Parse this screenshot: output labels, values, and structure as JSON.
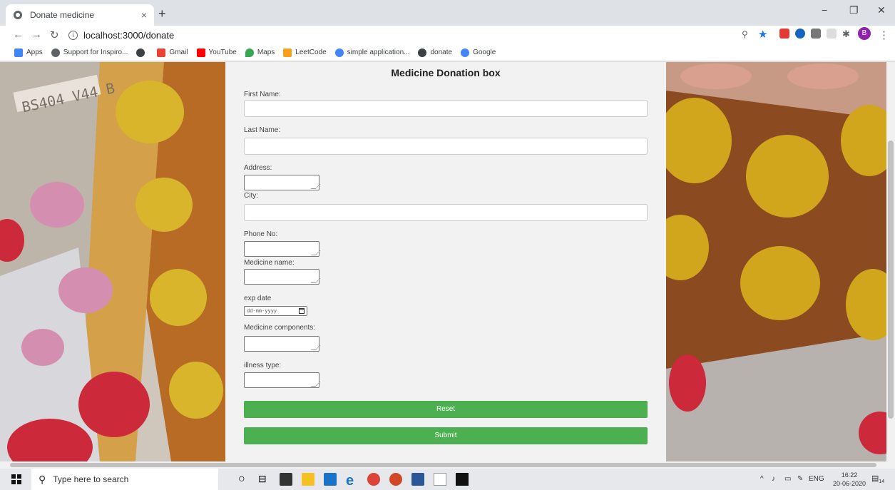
{
  "browser": {
    "tab_title": "Donate medicine",
    "tab_close": "×",
    "new_tab": "+",
    "url": "localhost:3000/donate",
    "minimize": "−",
    "restore": "❐",
    "close": "✕",
    "profile_initial": "B"
  },
  "bookmarks": [
    {
      "label": "Apps",
      "color": "#4285f4"
    },
    {
      "label": "Support for Inspiro...",
      "color": "#5f6368"
    },
    {
      "label": "",
      "color": "#3c4043"
    },
    {
      "label": "Gmail",
      "color": "#ea4335"
    },
    {
      "label": "YouTube",
      "color": "#ff0000"
    },
    {
      "label": "Maps",
      "color": "#34a853"
    },
    {
      "label": "LeetCode",
      "color": "#f89f1b"
    },
    {
      "label": "simple application...",
      "color": "#4285f4"
    },
    {
      "label": "donate",
      "color": "#3c4043"
    },
    {
      "label": "Google",
      "color": "#4285f4"
    }
  ],
  "form": {
    "title": "Medicine Donation box",
    "first_name_label": "First Name:",
    "last_name_label": "Last Name:",
    "address_label": "Address:",
    "city_label": "City:",
    "phone_label": "Phone No:",
    "medicine_name_label": "Medicine name:",
    "exp_date_label": "exp date",
    "exp_date_placeholder": "dd-mm-yyyy",
    "components_label": "Medicine components:",
    "illness_label": "illness type:",
    "reset_label": "Reset",
    "submit_label": "Submit"
  },
  "taskbar": {
    "search_placeholder": "Type here to search",
    "language": "ENG",
    "time": "16:22",
    "date": "20-06-2020",
    "notifications": "14"
  },
  "colors": {
    "button_green": "#4caf50",
    "form_bg": "#f2f2f2"
  }
}
